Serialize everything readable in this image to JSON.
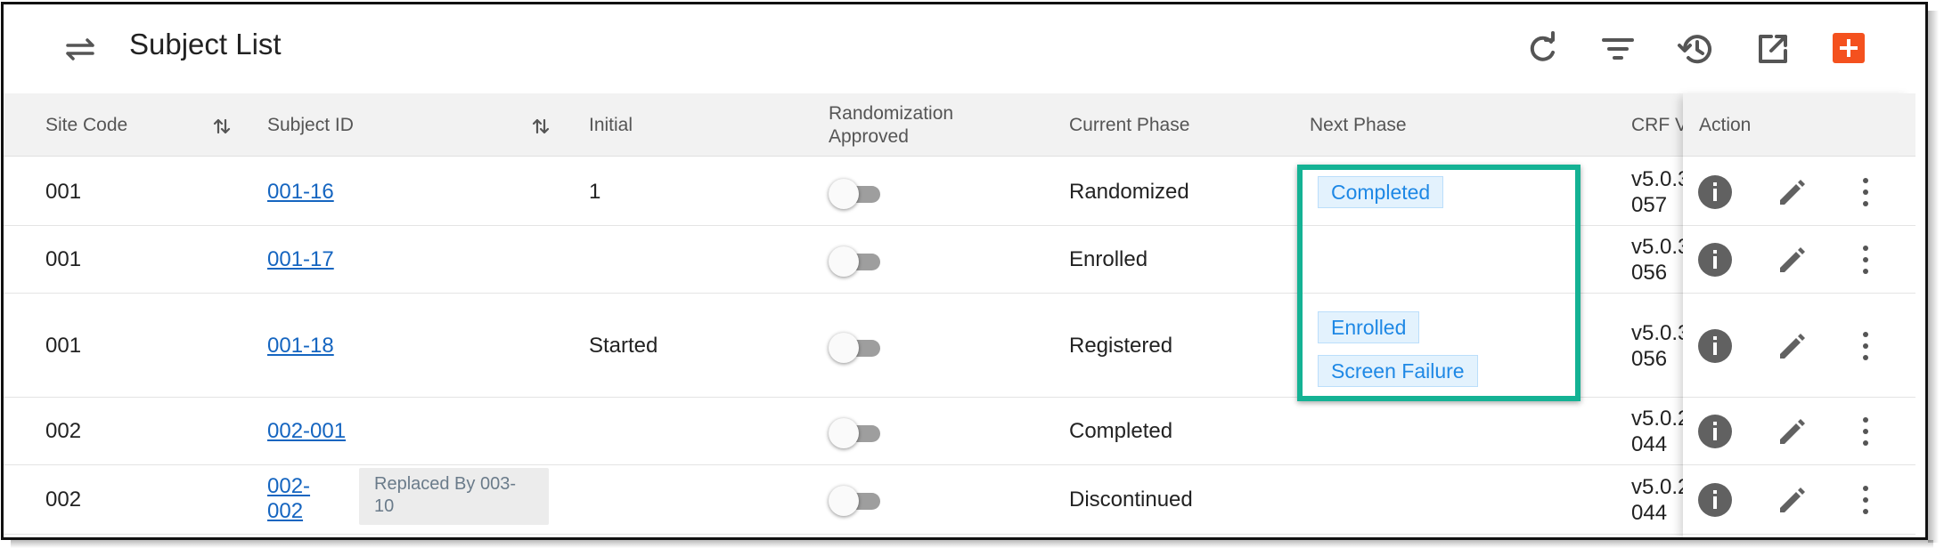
{
  "header": {
    "title": "Subject List",
    "toolbar": [
      "refresh-icon",
      "filter-icon",
      "history-icon",
      "open-external-icon",
      "add-icon"
    ],
    "accent_color": "#f4511e"
  },
  "table": {
    "columns": {
      "site_code": "Site Code",
      "subject_id": "Subject ID",
      "initial": "Initial",
      "randomization_line1": "Randomization",
      "randomization_line2": "Approved",
      "current_phase": "Current Phase",
      "next_phase": "Next Phase",
      "crf_version": "CRF V",
      "action": "Action"
    },
    "rows": [
      {
        "site_code": "001",
        "subject_id": "001-16",
        "initial": "1",
        "randomization_approved": false,
        "current_phase": "Randomized",
        "next_phases": [
          "Completed"
        ],
        "crf_line1": "v5.0.3",
        "crf_line2": "057"
      },
      {
        "site_code": "001",
        "subject_id": "001-17",
        "initial": "",
        "randomization_approved": false,
        "current_phase": "Enrolled",
        "next_phases": [],
        "crf_line1": "v5.0.3",
        "crf_line2": "056"
      },
      {
        "site_code": "001",
        "subject_id": "001-18",
        "initial": "Started",
        "randomization_approved": false,
        "current_phase": "Registered",
        "next_phases": [
          "Enrolled",
          "Screen Failure"
        ],
        "crf_line1": "v5.0.3",
        "crf_line2": "056"
      },
      {
        "site_code": "002",
        "subject_id": "002-001",
        "initial": "",
        "randomization_approved": false,
        "current_phase": "Completed",
        "next_phases": [],
        "crf_line1": "v5.0.2",
        "crf_line2": "044"
      },
      {
        "site_code": "002",
        "subject_id_line1": "002-",
        "subject_id_line2": "002",
        "replaced_by_line1": "Replaced By 003-",
        "replaced_by_line2": "10",
        "initial": "",
        "randomization_approved": false,
        "current_phase": "Discontinued",
        "next_phases": [],
        "crf_line1": "v5.0.2",
        "crf_line2": "044"
      }
    ]
  },
  "highlight_color": "#14b294"
}
